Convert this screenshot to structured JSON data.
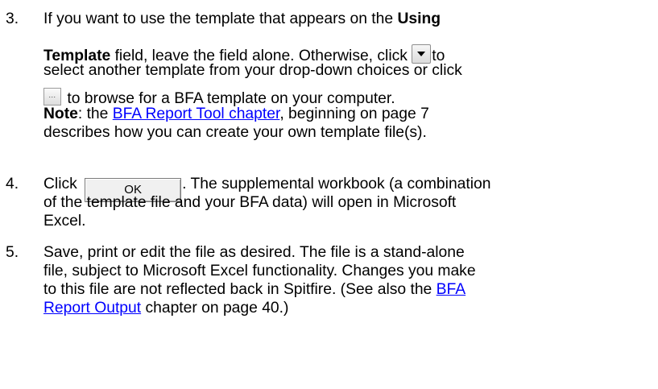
{
  "steps": [
    {
      "number": "3.",
      "line1_pre": "If you want to use the template that appears on the ",
      "line1_bold": "Using",
      "line2_bold": "Template",
      "line2_mid": " field, leave the field alone.  Otherwise, click ",
      "line2_post": "to",
      "line3": "select another template from your drop-down choices or click",
      "line4": " to browse for a BFA template on your computer.",
      "line5_bold": "Note",
      "line5_pre": ": the ",
      "line5_link": "BFA Report Tool chapter",
      "line5_post": ", beginning on page 7",
      "line6": "describes how you can create your own template file(s)."
    },
    {
      "number": "4.",
      "line1_pre": "Click ",
      "ok_label": "OK",
      "line1_post": ".  The supplemental workbook (a combination",
      "line2": "of the template file and your BFA data) will open in Microsoft",
      "line3": "Excel."
    },
    {
      "number": "5.",
      "line1": "Save, print or edit the file as desired.  The file is a stand-alone",
      "line2": "file, subject to Microsoft Excel functionality.  Changes you make",
      "line3_pre": "to this file are not reflected back in Spitfire.  (See also the ",
      "line3_link": "BFA",
      "line4_link": "Report Output",
      "line4_post": " chapter on page 40.)"
    }
  ],
  "icons": {
    "dropdown": "dropdown-arrow-icon",
    "browse_glyph": "..."
  }
}
